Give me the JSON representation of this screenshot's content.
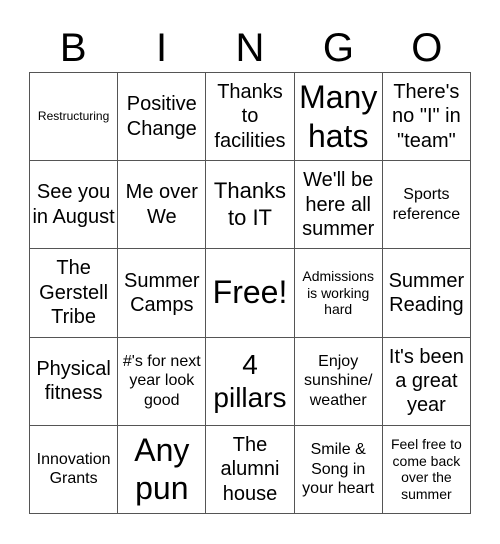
{
  "header": {
    "letters": [
      "B",
      "I",
      "N",
      "G",
      "O"
    ]
  },
  "board": {
    "rows": [
      [
        "Restructuring",
        "Positive Change",
        "Thanks to facilities",
        "Many hats",
        "There's no \"I\" in \"team\""
      ],
      [
        "See you in August",
        "Me over We",
        "Thanks to IT",
        "We'll be here all summer",
        "Sports reference"
      ],
      [
        "The Gerstell Tribe",
        "Summer Camps",
        "Free!",
        "Admissions is working hard",
        "Summer Reading"
      ],
      [
        "Physical fitness",
        "#'s for next year look good",
        "4 pillars",
        "Enjoy sunshine/ weather",
        "It's been a great year"
      ],
      [
        "Innovation Grants",
        "Any pun",
        "The alumni house",
        "Smile & Song in your heart",
        "Feel free to come back over the summer"
      ]
    ]
  }
}
